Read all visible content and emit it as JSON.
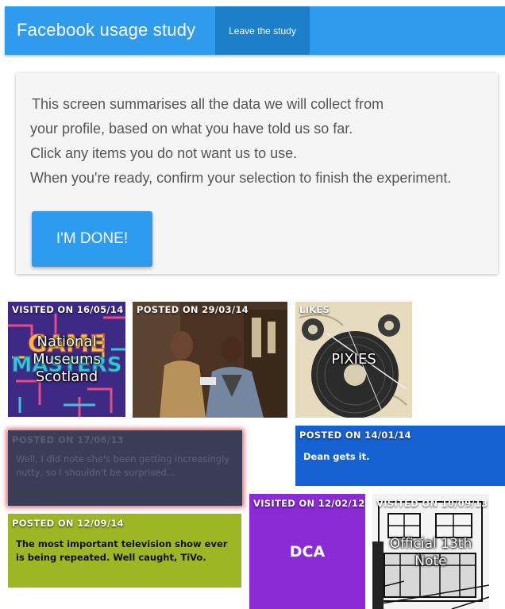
{
  "header": {
    "title": "Facebook usage study",
    "leave_label": "Leave the study"
  },
  "intro": {
    "lines": [
      "This screen summarises all the data we will collect from",
      "your profile, based on what you have told us so far.",
      "Click any items you do not want us to use.",
      "When you're ready, confirm your selection to finish the experiment."
    ],
    "done_label": "I'M DONE!"
  },
  "tiles": [
    {
      "label": "VISITED ON 16/05/14",
      "text": "National Museums Scotland"
    },
    {
      "label": "POSTED ON 29/03/14"
    },
    {
      "label": "LIKES",
      "text": "PIXIES"
    },
    {
      "label": "POSTED ON 17/06/13",
      "text": "Well, I did note she's been getting increasingly nutty, so I shouldn't be surprised..."
    },
    {
      "label": "POSTED ON 14/01/14",
      "text": "Dean gets it."
    },
    {
      "label": "POSTED ON 12/09/14",
      "text": "The most important television show ever is being repeated. Well caught, TiVo."
    },
    {
      "label": "VISITED ON 12/02/12",
      "text": "DCA"
    },
    {
      "label": "VISITED ON 10/09/13",
      "text": "Official 13th Note"
    }
  ],
  "colors": {
    "header": "#2f9bec",
    "leave_button": "#1d7fc9",
    "done_button": "#2d9cee",
    "deselected_tile": "#3c3e58",
    "deselected_border": "#e35a5a",
    "blue_tile": "#1662d2",
    "olive_tile": "#9cb624",
    "purple_tile": "#8a2bd6"
  }
}
